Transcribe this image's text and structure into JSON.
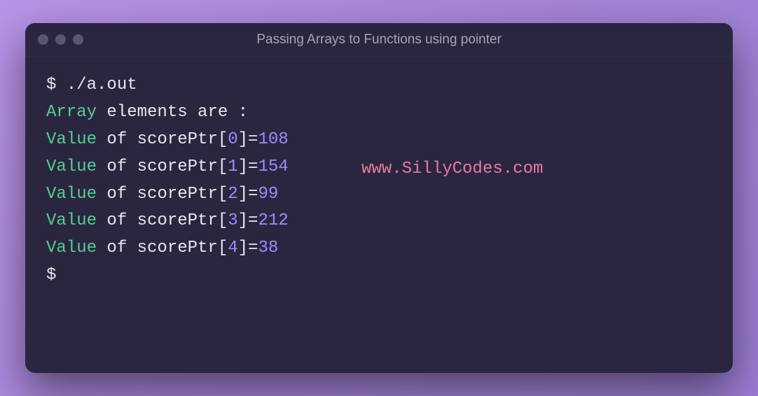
{
  "titlebar": {
    "title": "Passing Arrays to Functions using pointer"
  },
  "terminal": {
    "prompt": "$",
    "command": "./a.out",
    "header_word1": "Array",
    "header_rest": " elements are :",
    "lines": [
      {
        "label": "Value",
        "of": " of scorePtr[",
        "idx": "0",
        "close": "]=",
        "val": "108"
      },
      {
        "label": "Value",
        "of": " of scorePtr[",
        "idx": "1",
        "close": "]=",
        "val": "154"
      },
      {
        "label": "Value",
        "of": " of scorePtr[",
        "idx": "2",
        "close": "]=",
        "val": "99"
      },
      {
        "label": "Value",
        "of": " of scorePtr[",
        "idx": "3",
        "close": "]=",
        "val": "212"
      },
      {
        "label": "Value",
        "of": " of scorePtr[",
        "idx": "4",
        "close": "]=",
        "val": "38"
      }
    ],
    "end_prompt": "$"
  },
  "watermark": "www.SillyCodes.com"
}
